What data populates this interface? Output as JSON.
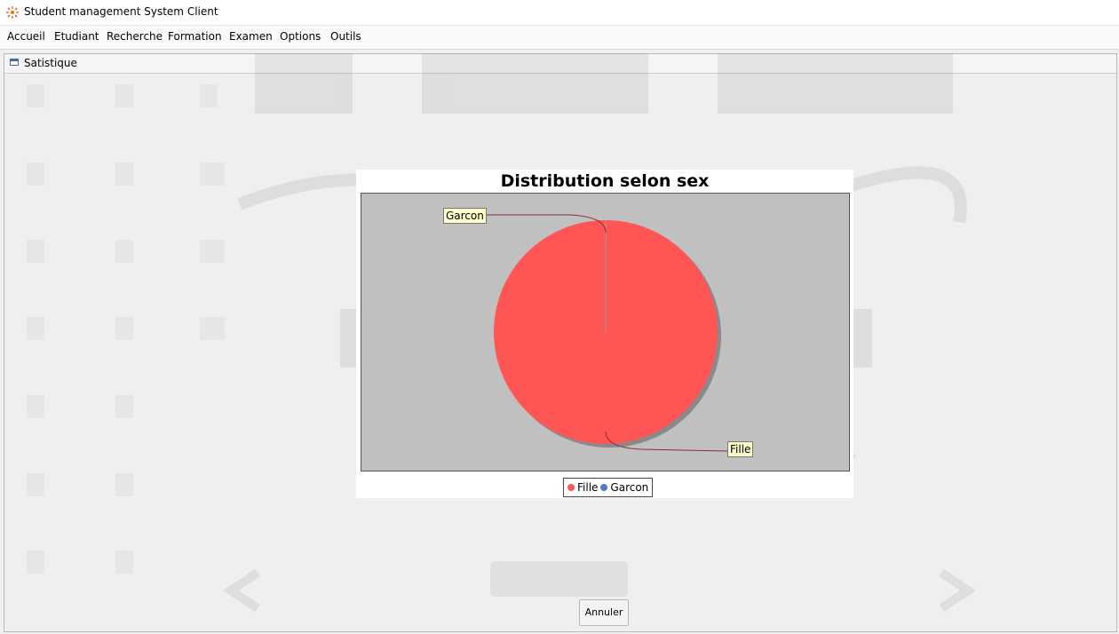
{
  "window": {
    "title": "Student management System Client"
  },
  "menu": {
    "items": [
      "Accueil",
      "Etudiant",
      "Recherche",
      "Formation",
      "Examen",
      "Options",
      "Outils"
    ]
  },
  "internal_frame": {
    "title": "Satistique"
  },
  "chart_data": {
    "type": "pie",
    "title": "Distribution selon sex",
    "categories": [
      "Fille",
      "Garcon"
    ],
    "values": [
      100,
      0
    ],
    "colors": [
      "#ff5555",
      "#5577cc"
    ],
    "legend": [
      "Fille",
      "Garcon"
    ],
    "legend_position": "bottom",
    "plot_background": "#c0c0c0",
    "slice_labels": [
      "Fille",
      "Garcon"
    ]
  },
  "footer": {
    "cancel_label": "Annuler"
  },
  "icons": {
    "app": "app-logo-icon",
    "frame": "window-icon"
  }
}
